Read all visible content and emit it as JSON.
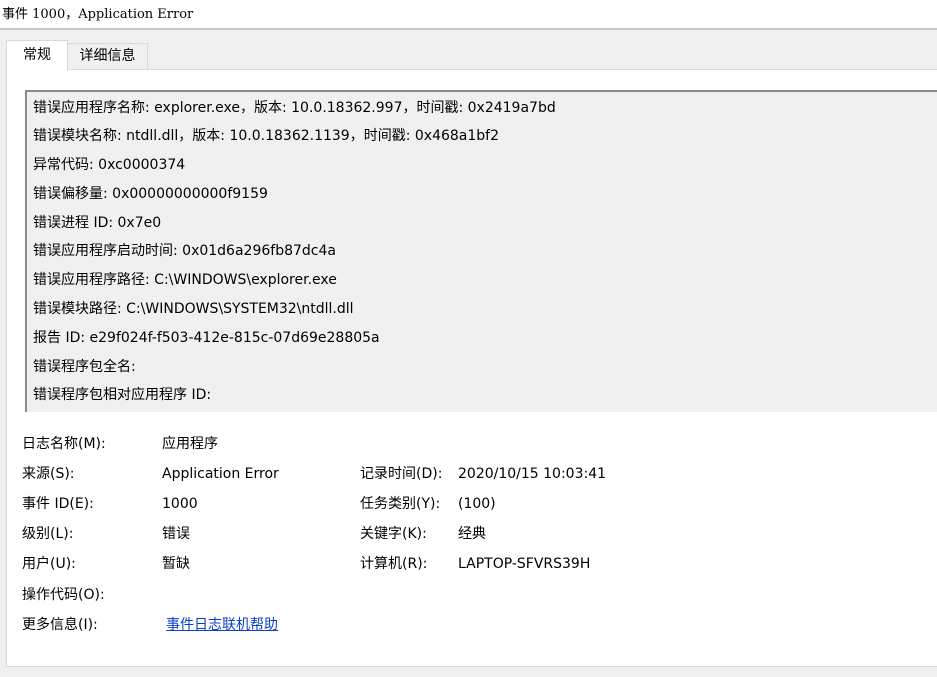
{
  "window": {
    "title": "事件 1000，Application Error"
  },
  "tabs": [
    {
      "label": "常规",
      "active": true
    },
    {
      "label": "详细信息",
      "active": false
    }
  ],
  "description_lines": [
    "错误应用程序名称: explorer.exe，版本: 10.0.18362.997，时间戳: 0x2419a7bd",
    "错误模块名称: ntdll.dll，版本: 10.0.18362.1139，时间戳: 0x468a1bf2",
    "异常代码: 0xc0000374",
    "错误偏移量: 0x00000000000f9159",
    "错误进程 ID: 0x7e0",
    "错误应用程序启动时间: 0x01d6a296fb87dc4a",
    "错误应用程序路径: C:\\WINDOWS\\explorer.exe",
    "错误模块路径: C:\\WINDOWS\\SYSTEM32\\ntdll.dll",
    "报告 ID: e29f024f-f503-412e-815c-07d69e28805a",
    "错误程序包全名:",
    "错误程序包相对应用程序 ID:"
  ],
  "details": {
    "log_name": {
      "label": "日志名称(M):",
      "value": "应用程序"
    },
    "source": {
      "label": "来源(S):",
      "value": "Application Error"
    },
    "logged": {
      "label": "记录时间(D):",
      "value": "2020/10/15 10:03:41"
    },
    "event_id": {
      "label": "事件 ID(E):",
      "value": "1000"
    },
    "task_category": {
      "label": "任务类别(Y):",
      "value": "(100)"
    },
    "level": {
      "label": "级别(L):",
      "value": "错误"
    },
    "keywords": {
      "label": "关键字(K):",
      "value": "经典"
    },
    "user": {
      "label": "用户(U):",
      "value": "暂缺"
    },
    "computer": {
      "label": "计算机(R):",
      "value": "LAPTOP-SFVRS39H"
    },
    "opcode": {
      "label": "操作代码(O):"
    },
    "more_info": {
      "label": "更多信息(I):",
      "link": "事件日志联机帮助"
    }
  },
  "colors": {
    "link": "#0a3fc9",
    "panel": "#ffffff",
    "background": "#f0f0f0"
  }
}
